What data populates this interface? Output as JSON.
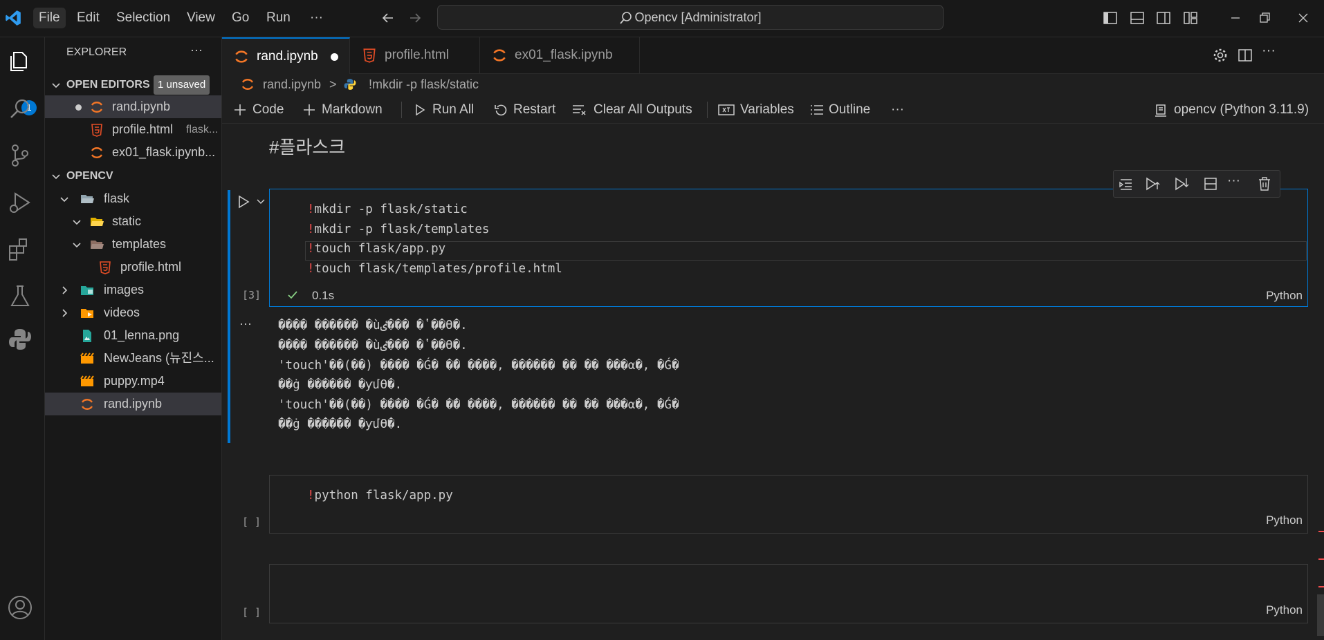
{
  "titlebar": {
    "menus": [
      "File",
      "Edit",
      "Selection",
      "View",
      "Go",
      "Run"
    ],
    "more": "···",
    "command_center": "Opencv [Administrator]"
  },
  "activity": {
    "badge": "1"
  },
  "sidebar": {
    "title": "EXPLORER",
    "more": "···",
    "open_editors": {
      "header": "OPEN EDITORS",
      "badge": "1 unsaved",
      "items": [
        {
          "name": "rand.ipynb",
          "desc": "",
          "icon": "jupyter-icon"
        },
        {
          "name": "profile.html",
          "desc": "flask...",
          "icon": "html-icon"
        },
        {
          "name": "ex01_flask.ipynb...",
          "desc": "",
          "icon": "jupyter-icon"
        }
      ]
    },
    "workspace": {
      "header": "OPENCV",
      "items": [
        {
          "name": "flask",
          "type": "folder-open"
        },
        {
          "name": "static",
          "type": "folder-open"
        },
        {
          "name": "templates",
          "type": "folder-open"
        },
        {
          "name": "profile.html",
          "type": "html"
        },
        {
          "name": "images",
          "type": "folder"
        },
        {
          "name": "videos",
          "type": "folder"
        },
        {
          "name": "01_lenna.png",
          "type": "image"
        },
        {
          "name": "NewJeans (뉴진스...",
          "type": "video"
        },
        {
          "name": "puppy.mp4",
          "type": "video"
        },
        {
          "name": "rand.ipynb",
          "type": "jupyter"
        }
      ]
    }
  },
  "tabs": [
    {
      "label": "rand.ipynb",
      "modified": true
    },
    {
      "label": "profile.html"
    },
    {
      "label": "ex01_flask.ipynb"
    }
  ],
  "breadcrumb": {
    "file": "rand.ipynb",
    "sep": ">",
    "cell": "!mkdir -p flask/static"
  },
  "toolbar": {
    "code": "Code",
    "markdown": "Markdown",
    "run_all": "Run All",
    "restart": "Restart",
    "clear": "Clear All Outputs",
    "variables": "Variables",
    "outline": "Outline",
    "more": "···",
    "kernel": "opencv (Python 3.11.9)"
  },
  "notebook": {
    "markdown_cell": "#플라스크",
    "cell1": {
      "lines": [
        {
          "bang": "!",
          "text": "mkdir -p flask/static"
        },
        {
          "bang": "!",
          "text": "mkdir -p flask/templates"
        },
        {
          "bang": "!",
          "text": "touch flask/app.py"
        },
        {
          "bang": "!",
          "text": "touch flask/templates/profile.html"
        }
      ],
      "exec_count": "[3]",
      "time": "0.1s",
      "language": "Python"
    },
    "output": {
      "lines": [
        "���� ������ �ùٸ��� �ʽ��ϴ�.",
        "���� ������ �ùٸ��� �ʽ��ϴ�.",
        "'touch'��(��) ���� �Ǵ� �ܺ� ����, ������ �� �� ���α׷�, �Ǵ�",
        "��ġ ������ �ƴմϴ�.",
        "'touch'��(��) ���� �Ǵ� �ܺ� ����, ������ �� �� ���α׷�, �Ǵ�",
        "��ġ ������ �ƴմϴ�."
      ],
      "more": "···"
    },
    "cell2": {
      "lines": [
        {
          "bang": "!",
          "text": "python flask/app.py"
        }
      ],
      "exec_count": "[ ]",
      "language": "Python"
    },
    "cell3": {
      "exec_count": "[ ]",
      "language": "Python"
    }
  }
}
